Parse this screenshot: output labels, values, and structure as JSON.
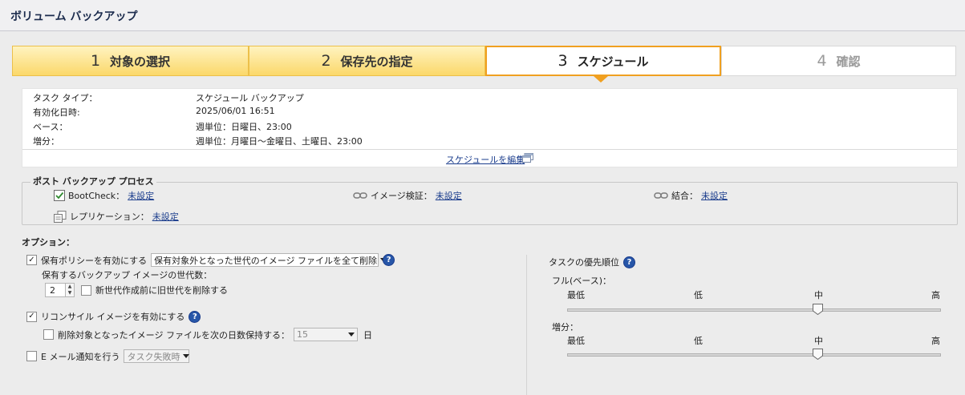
{
  "window": {
    "title": "ボリューム バックアップ"
  },
  "wizard": {
    "steps": [
      {
        "num": "1",
        "label": "対象の選択",
        "state": "done"
      },
      {
        "num": "2",
        "label": "保存先の指定",
        "state": "done"
      },
      {
        "num": "3",
        "label": "スケジュール",
        "state": "current"
      },
      {
        "num": "4",
        "label": "確認",
        "state": "todo"
      }
    ]
  },
  "summary": {
    "rows": [
      {
        "label": "タスク タイプ：",
        "value": "スケジュール バックアップ"
      },
      {
        "label": "有効化日時:",
        "value": "2025/06/01 16:51"
      },
      {
        "label": "ベース：",
        "value": "週単位：日曜日、23:00"
      },
      {
        "label": "増分：",
        "value": "週単位：月曜日～金曜日、土曜日、23:00"
      }
    ],
    "edit_link": "スケジュールを編集"
  },
  "post_process": {
    "legend": "ポスト バックアップ プロセス",
    "bootcheck_label": "BootCheck：",
    "bootcheck_value": "未設定",
    "verify_label": "イメージ検証：",
    "verify_value": "未設定",
    "merge_label": "結合：",
    "merge_value": "未設定",
    "replication_label": "レプリケーション：",
    "replication_value": "未設定"
  },
  "options": {
    "heading": "オプション：",
    "retention_label": "保有ポリシーを有効にする",
    "retention_select": "保有対象外となった世代のイメージ ファイルを全て削除",
    "generations_label": "保有するバックアップ イメージの世代数：",
    "generations_value": "2",
    "delete_before_label": "新世代作成前に旧世代を削除する",
    "reconcile_label": "リコンサイル イメージを有効にする",
    "keep_deleted_label": "削除対象となったイメージ ファイルを次の日数保持する：",
    "keep_deleted_value": "15",
    "days_unit": "日",
    "email_label": "E メール通知を行う",
    "email_select": "タスク失敗時"
  },
  "priority": {
    "heading": "タスクの優先順位",
    "full_label": "フル(ベース)：",
    "incr_label": "増分：",
    "ticks": [
      "最低",
      "低",
      "中",
      "高"
    ],
    "full_level": 0.67,
    "incr_level": 0.67
  },
  "icons": {
    "check": "✓",
    "checked_box": "✓",
    "help": "?"
  },
  "colors": {
    "accent": "#f0a020",
    "link": "#1a3c8c",
    "help": "#2756a8"
  }
}
